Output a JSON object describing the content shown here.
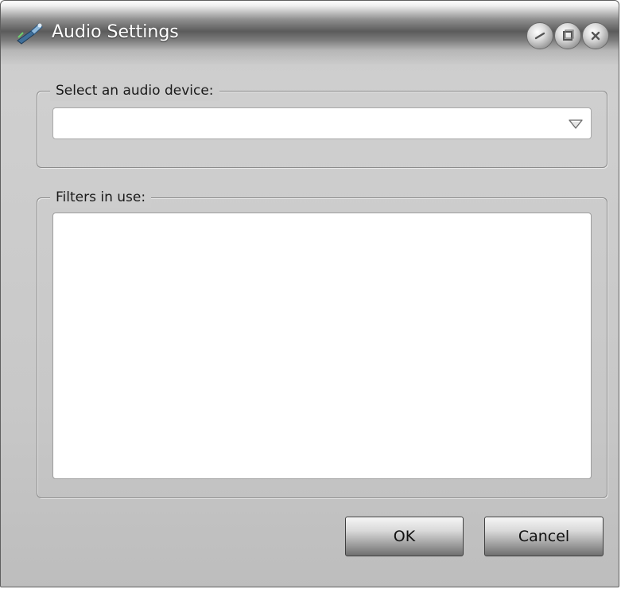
{
  "window": {
    "title": "Audio Settings"
  },
  "caption_buttons": {
    "minimize_icon": "minimize-icon",
    "maximize_icon": "maximize-icon",
    "close_icon": "close-icon"
  },
  "device_group": {
    "legend": "Select an audio device:",
    "combo_value": ""
  },
  "filters_group": {
    "legend": "Filters in use:",
    "items": []
  },
  "buttons": {
    "ok_label": "OK",
    "cancel_label": "Cancel"
  }
}
